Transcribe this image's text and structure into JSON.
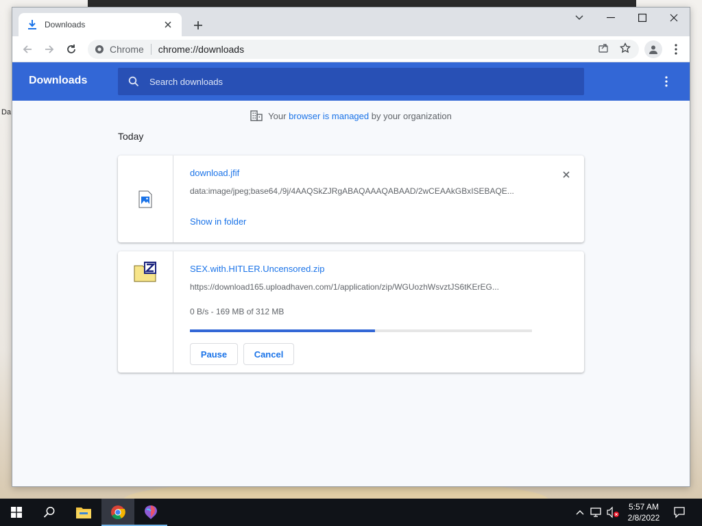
{
  "browser": {
    "tab_title": "Downloads",
    "omnibox_site": "Chrome",
    "omnibox_url": "chrome://downloads"
  },
  "downloads_page": {
    "title": "Downloads",
    "search_placeholder": "Search downloads",
    "managed_notice": {
      "prefix": "Your",
      "link": "browser is managed",
      "suffix": "by your organization"
    },
    "section_date": "Today",
    "items": [
      {
        "file_name": "download.jfif",
        "url": "data:image/jpeg;base64,/9j/4AAQSkZJRgABAQAAAQABAAD/2wCEAAkGBxISEBAQE...",
        "action": "Show in folder",
        "icon": "image-file-icon"
      },
      {
        "file_name": "SEX.with.HITLER.Uncensored.zip",
        "url": "https://download165.uploadhaven.com/1/application/zip/WGUozhWsvztJS6tKErEG...",
        "status": "0 B/s - 169 MB of 312 MB",
        "progress": 0.542,
        "pause_label": "Pause",
        "cancel_label": "Cancel",
        "icon": "zip-archive-icon"
      }
    ]
  },
  "desktop": {
    "partial_label": "Da"
  },
  "taskbar": {
    "time": "5:57 AM",
    "date": "2/8/2022"
  },
  "colors": {
    "accent": "#3367d6",
    "link": "#1a73e8",
    "taskbar": "#101318"
  }
}
